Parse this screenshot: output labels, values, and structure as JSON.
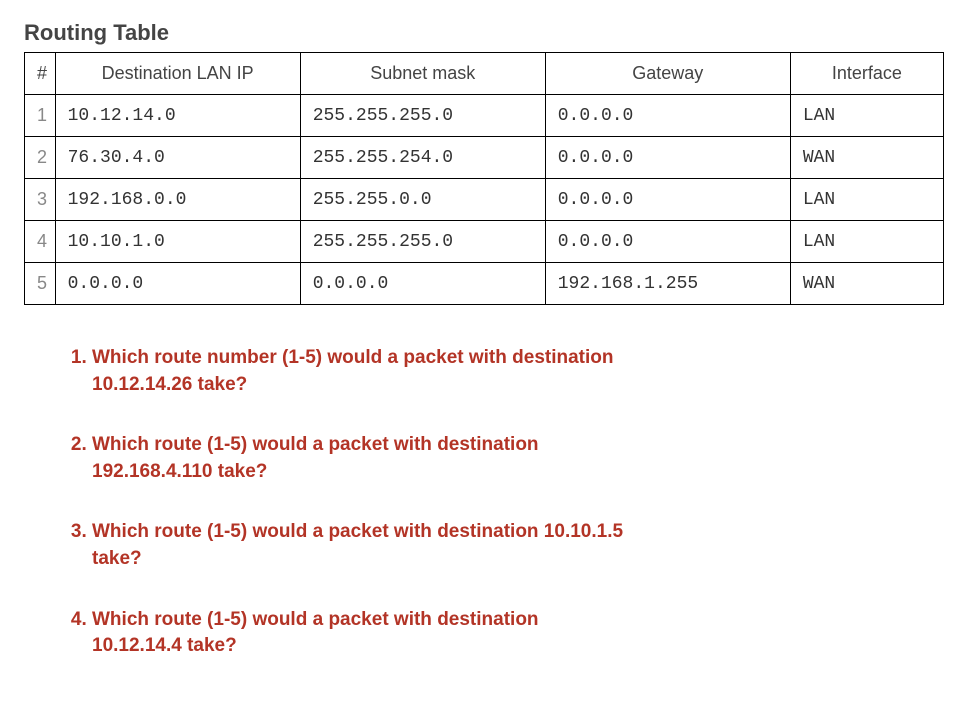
{
  "title": "Routing Table",
  "columns": {
    "num": "#",
    "dest": "Destination LAN IP",
    "mask": "Subnet mask",
    "gateway": "Gateway",
    "iface": "Interface"
  },
  "rows": [
    {
      "num": "1",
      "dest": "10.12.14.0",
      "mask": "255.255.255.0",
      "gateway": "0.0.0.0",
      "iface": "LAN"
    },
    {
      "num": "2",
      "dest": "76.30.4.0",
      "mask": "255.255.254.0",
      "gateway": "0.0.0.0",
      "iface": "WAN"
    },
    {
      "num": "3",
      "dest": "192.168.0.0",
      "mask": "255.255.0.0",
      "gateway": "0.0.0.0",
      "iface": "LAN"
    },
    {
      "num": "4",
      "dest": "10.10.1.0",
      "mask": "255.255.255.0",
      "gateway": "0.0.0.0",
      "iface": "LAN"
    },
    {
      "num": "5",
      "dest": "0.0.0.0",
      "mask": "0.0.0.0",
      "gateway": "192.168.1.255",
      "iface": "WAN"
    }
  ],
  "questions": [
    "Which route number (1-5) would a packet with destination 10.12.14.26 take?",
    "Which route (1-5) would a packet with destination 192.168.4.110 take?",
    "Which route (1-5) would a packet with destination 10.10.1.5 take?",
    "Which route (1-5) would a packet with destination 10.12.14.4 take?"
  ]
}
